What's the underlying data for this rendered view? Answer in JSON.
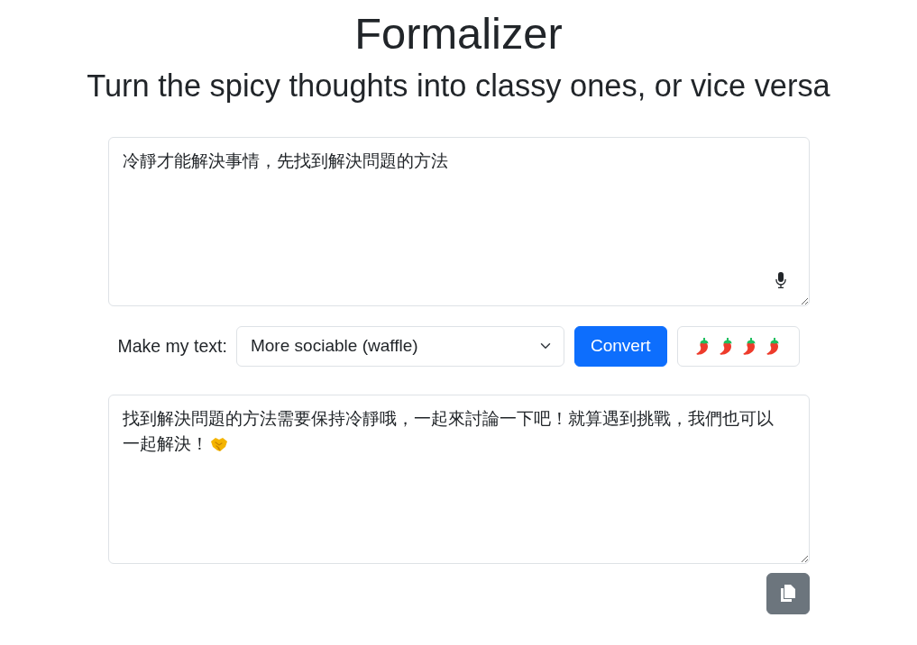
{
  "header": {
    "title": "Formalizer",
    "subtitle": "Turn the spicy thoughts into classy ones, or vice versa"
  },
  "input": {
    "value": "冷靜才能解決事情，先找到解決問題的方法"
  },
  "controls": {
    "label": "Make my text:",
    "mode": "More sociable (waffle)",
    "convert_button": "Convert"
  },
  "output": {
    "value": "找到解決問題的方法需要保持冷靜哦，一起來討論一下吧！就算遇到挑戰，我們也可以一起解決！"
  }
}
